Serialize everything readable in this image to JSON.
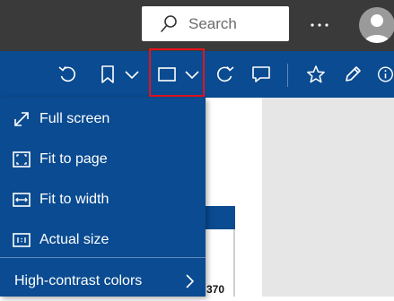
{
  "titlebar": {
    "search": {
      "placeholder": "Search",
      "icon": "search-icon"
    },
    "more": {
      "icon": "more-horizontal-icon",
      "label": "···"
    },
    "avatar": {
      "icon": "user-avatar-icon"
    }
  },
  "toolbar": {
    "buttons": [
      {
        "name": "rotate-left",
        "icon": "rotate-left-icon"
      },
      {
        "name": "bookmark",
        "icon": "bookmark-icon"
      },
      {
        "name": "bookmark-dropdown",
        "icon": "chevron-down-icon"
      },
      {
        "name": "page-view",
        "icon": "page-view-icon",
        "highlighted": true
      },
      {
        "name": "page-view-dropdown",
        "icon": "chevron-down-icon"
      },
      {
        "name": "refresh",
        "icon": "refresh-icon"
      },
      {
        "name": "comment",
        "icon": "comment-icon"
      },
      {
        "name": "favorite",
        "icon": "star-icon"
      },
      {
        "name": "draw",
        "icon": "pencil-icon"
      },
      {
        "name": "info",
        "icon": "info-icon"
      }
    ],
    "colors": {
      "background": "#0a4b91",
      "highlight": "#e3141c"
    }
  },
  "menu": {
    "items": [
      {
        "label": "Full screen",
        "icon": "full-screen-icon"
      },
      {
        "label": "Fit to page",
        "icon": "fit-to-page-icon"
      },
      {
        "label": "Fit to width",
        "icon": "fit-to-width-icon"
      },
      {
        "label": "Actual size",
        "icon": "actual-size-icon"
      }
    ],
    "submenu_item": {
      "label": "High-contrast colors",
      "icon": "chevron-right-icon"
    }
  },
  "document": {
    "visible_number": "370"
  }
}
